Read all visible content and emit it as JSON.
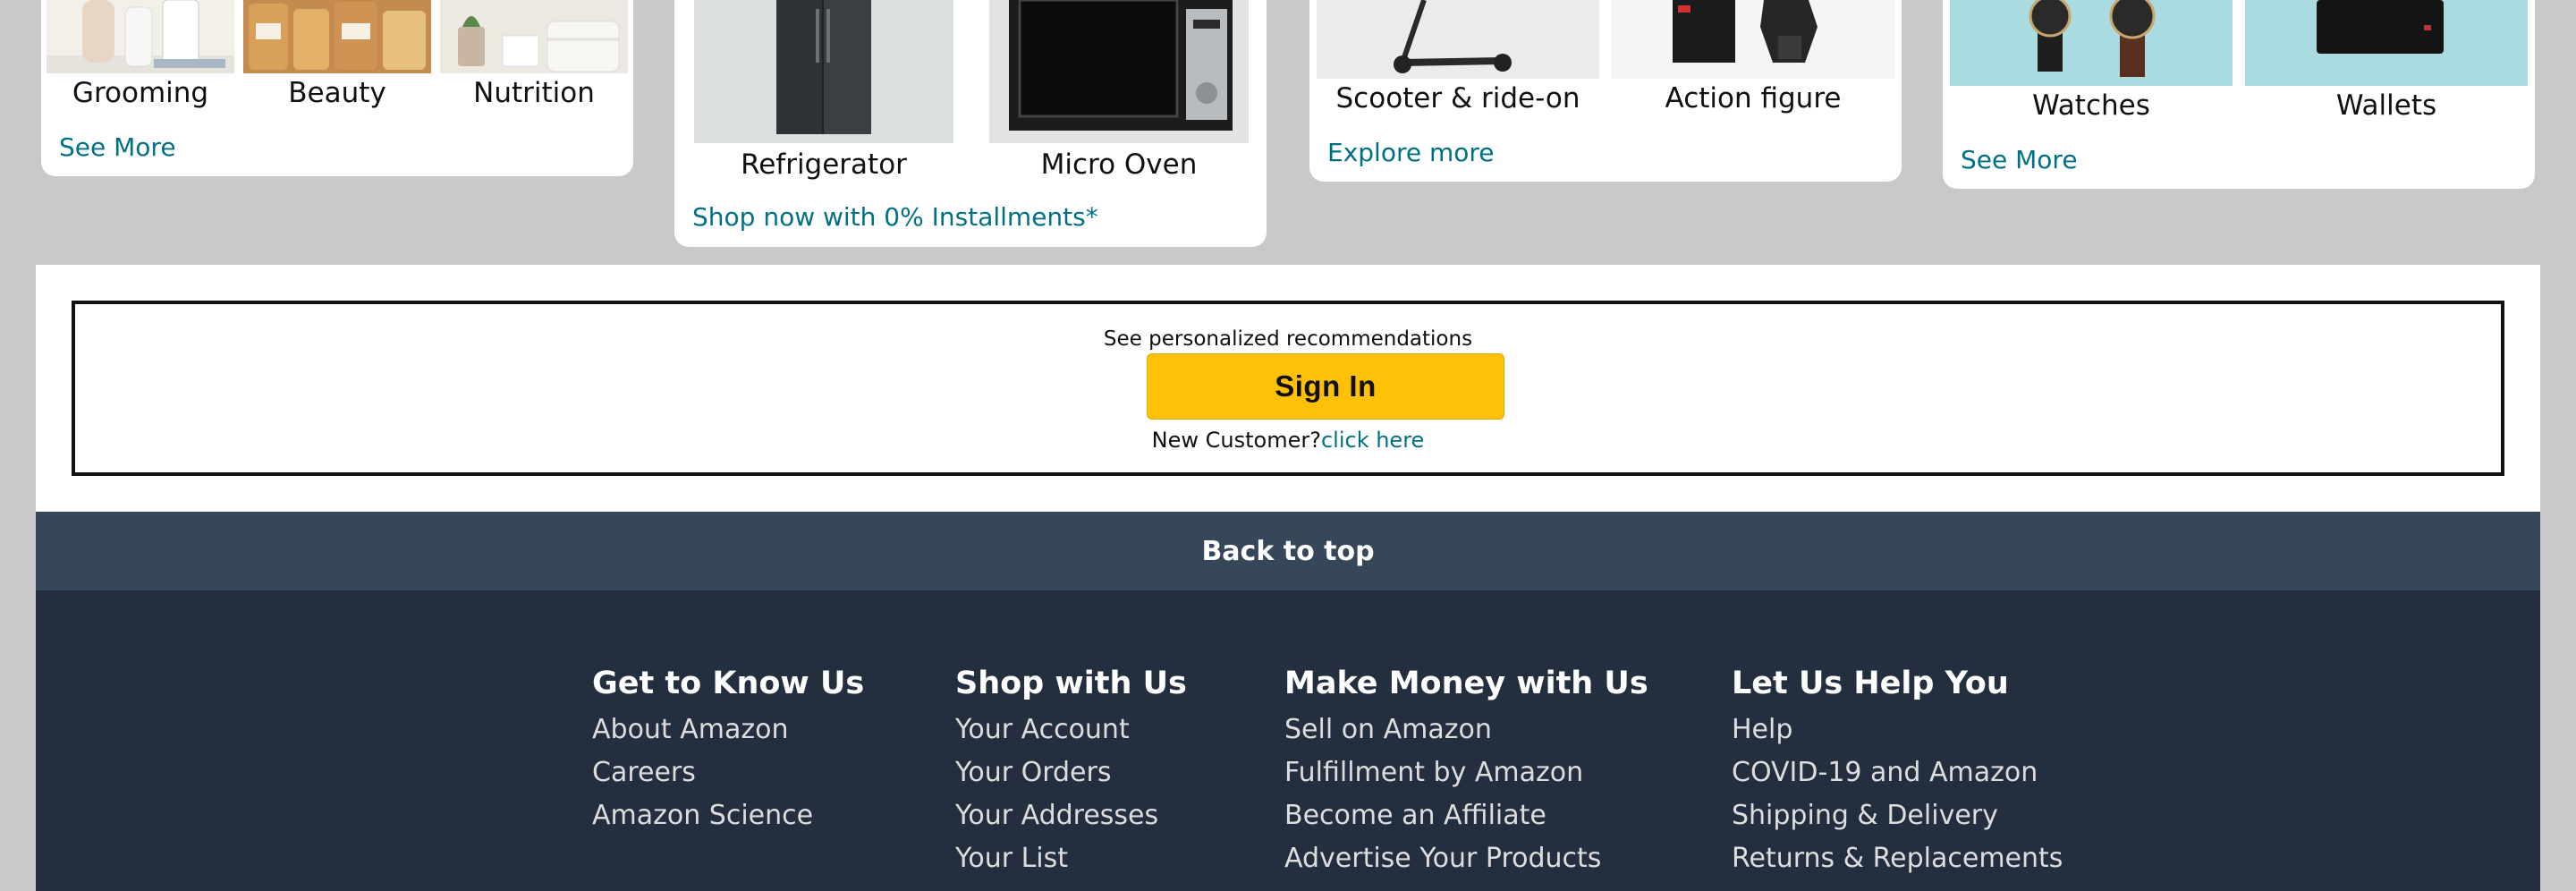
{
  "cards": [
    {
      "tiles": [
        {
          "label": "Grooming"
        },
        {
          "label": "Beauty"
        },
        {
          "label": "Nutrition"
        }
      ],
      "link": "See More"
    },
    {
      "tiles": [
        {
          "label": "Refrigerator"
        },
        {
          "label": "Micro Oven"
        }
      ],
      "link": "Shop now with 0% Installments*"
    },
    {
      "tiles": [
        {
          "label": "Scooter & ride-on"
        },
        {
          "label": "Action figure"
        }
      ],
      "link": "Explore more"
    },
    {
      "tiles": [
        {
          "label": "Watches"
        },
        {
          "label": "Wallets"
        }
      ],
      "link": "See More"
    }
  ],
  "signin": {
    "note": "See personalized recommendations",
    "button_label": "Sign In",
    "new_customer_text": "New Customer?",
    "new_customer_link": "click here"
  },
  "back_to_top": "Back to top",
  "footer": {
    "columns": [
      {
        "heading": "Get to Know Us",
        "links": [
          "About Amazon",
          "Careers",
          "Amazon Science"
        ]
      },
      {
        "heading": "Shop with Us",
        "links": [
          "Your Account",
          "Your Orders",
          "Your Addresses",
          "Your List"
        ]
      },
      {
        "heading": "Make Money with Us",
        "links": [
          "Sell on Amazon",
          "Fulfillment by Amazon",
          "Become an Affiliate",
          "Advertise Your Products"
        ]
      },
      {
        "heading": "Let Us Help You",
        "links": [
          "Help",
          "COVID-19 and Amazon",
          "Shipping & Delivery",
          "Returns & Replacements"
        ]
      }
    ]
  },
  "colors": {
    "link": "#007185",
    "signin_button": "#ffc107",
    "back_to_top_bg": "#37475a",
    "footer_bg": "#232f3e",
    "page_bg": "#c8c9c8"
  }
}
